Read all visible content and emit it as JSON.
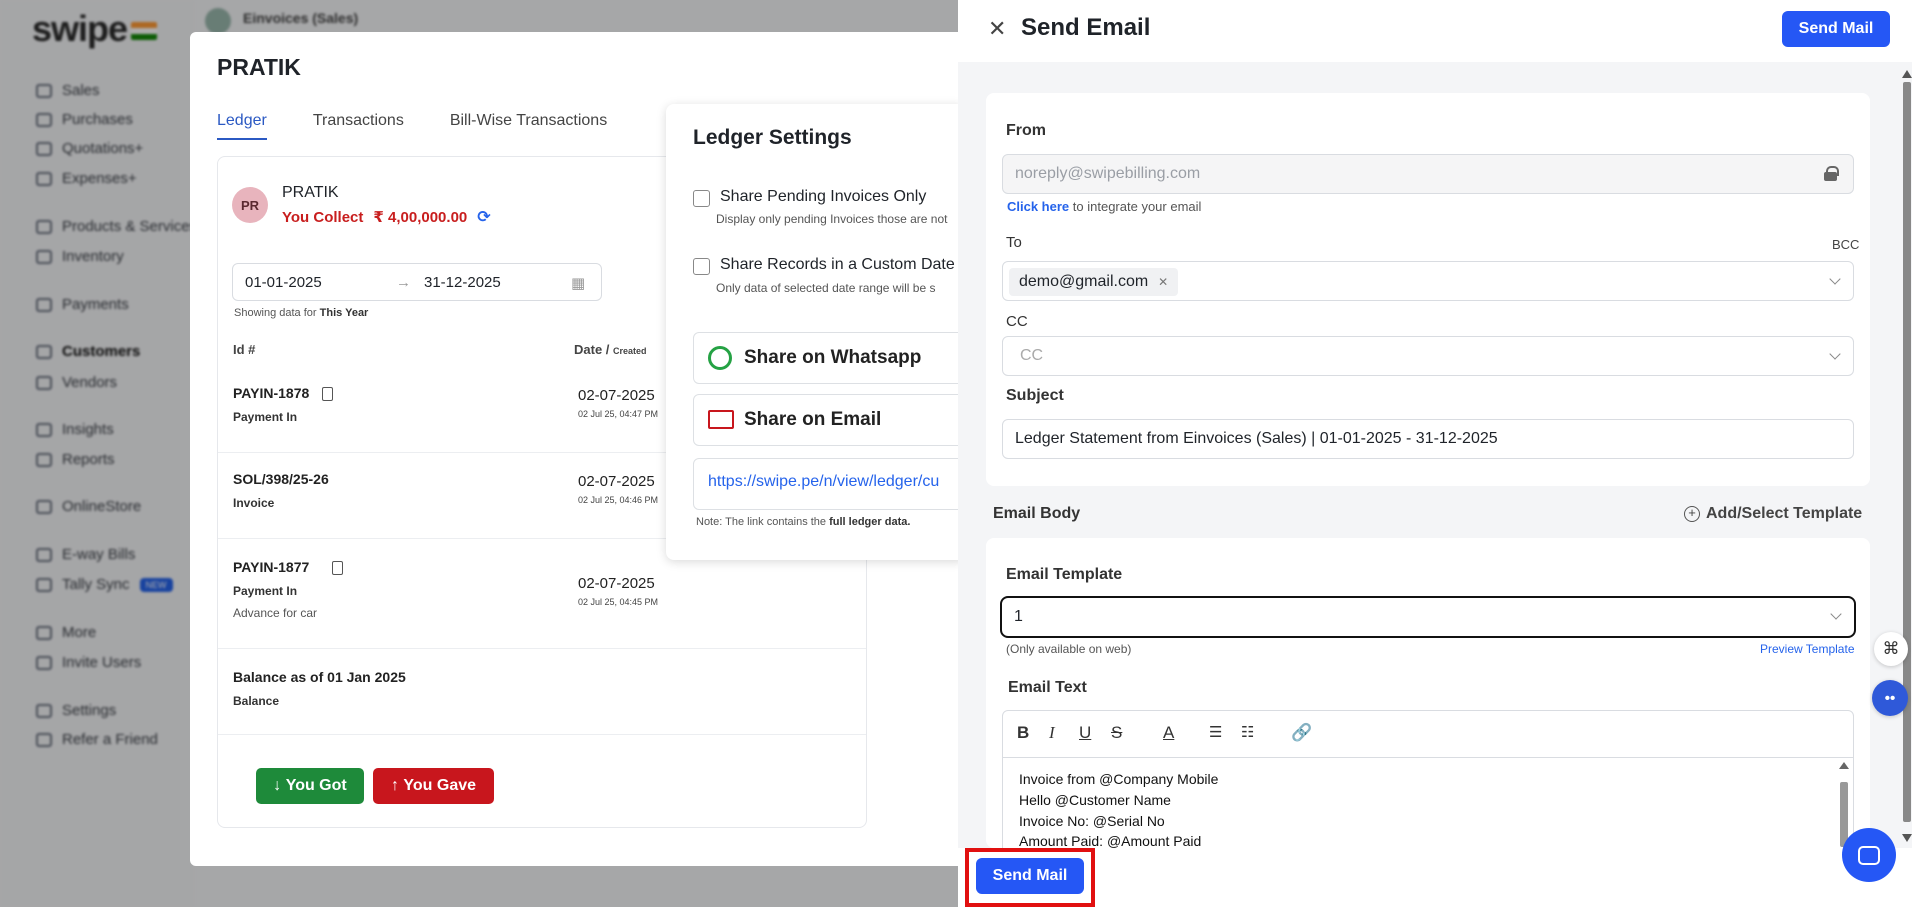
{
  "app": {
    "logo": "swipe",
    "company": "Einvoices (Sales)"
  },
  "sidebar": {
    "items": [
      {
        "label": "Sales"
      },
      {
        "label": "Purchases"
      },
      {
        "label": "Quotations+"
      },
      {
        "label": "Expenses+"
      },
      {
        "label": "Products & Services"
      },
      {
        "label": "Inventory"
      },
      {
        "label": "Payments"
      },
      {
        "label": "Customers"
      },
      {
        "label": "Vendors"
      },
      {
        "label": "Insights"
      },
      {
        "label": "Reports"
      },
      {
        "label": "OnlineStore"
      },
      {
        "label": "E-way Bills"
      },
      {
        "label": "Tally Sync",
        "badge": "NEW"
      },
      {
        "label": "More"
      },
      {
        "label": "Invite Users"
      },
      {
        "label": "Settings"
      },
      {
        "label": "Refer a Friend"
      }
    ]
  },
  "ledger": {
    "title": "PRATIK",
    "tabs": [
      "Ledger",
      "Transactions",
      "Bill-Wise Transactions"
    ],
    "avatar": "PR",
    "party_name": "PRATIK",
    "collect_label": "You Collect",
    "collect_amount": "₹ 4,00,000.00",
    "date_from": "01-01-2025",
    "date_to": "31-12-2025",
    "showing_prefix": "Showing data for",
    "showing_period": "This Year",
    "col_id": "Id #",
    "col_date": "Date /",
    "col_date_sub": "Created",
    "rows": [
      {
        "id": "PAYIN-1878",
        "type": "Payment In",
        "date": "02-07-2025",
        "time": "02 Jul 25, 04:47 PM",
        "note": ""
      },
      {
        "id": "SOL/398/25-26",
        "type": "Invoice",
        "date": "02-07-2025",
        "time": "02 Jul 25, 04:46 PM",
        "note": ""
      },
      {
        "id": "PAYIN-1877",
        "type": "Payment In",
        "date": "02-07-2025",
        "time": "02 Jul 25, 04:45 PM",
        "note": "Advance for car"
      },
      {
        "id": "Balance as of 01 Jan 2025",
        "type": "Balance",
        "date": "",
        "time": "",
        "note": ""
      }
    ],
    "btn_got": "You Got",
    "btn_gave": "You Gave"
  },
  "ledger_settings": {
    "title": "Ledger Settings",
    "opt1_label": "Share Pending Invoices Only",
    "opt1_desc": "Display only pending Invoices those are not",
    "opt2_label": "Share Records in a Custom Date",
    "opt2_desc": "Only data of selected date range will be s",
    "whatsapp": "Share on Whatsapp",
    "email": "Share on Email",
    "link": "https://swipe.pe/n/view/ledger/cu",
    "note_prefix": "Note: The link contains the",
    "note_bold": "full ledger data."
  },
  "send_email": {
    "title": "Send Email",
    "send_top": "Send Mail",
    "from_label": "From",
    "from_value": "noreply@swipebilling.com",
    "click_here": "Click here",
    "integrate": "to integrate your email",
    "to_label": "To",
    "bcc": "BCC",
    "to_tag": "demo@gmail.com",
    "cc_label": "CC",
    "cc_placeholder": "CC",
    "subject_label": "Subject",
    "subject_value": "Ledger Statement from Einvoices (Sales) | 01-01-2025 - 31-12-2025",
    "email_body_label": "Email Body",
    "add_template": "Add/Select Template",
    "template_label": "Email Template",
    "template_value": "1",
    "only_web": "(Only available on web)",
    "preview_template": "Preview Template",
    "email_text_label": "Email Text",
    "body_lines": [
      "Invoice from @Company Mobile",
      "Hello @Customer Name",
      "Invoice No: @Serial No",
      "Amount Paid: @Amount Paid"
    ],
    "send_bottom": "Send Mail"
  },
  "colors": {
    "primary": "#2557f5",
    "highlight": "#e11010",
    "collect": "#c81e1e",
    "got": "#1e8a3a",
    "gave": "#c8161d"
  }
}
